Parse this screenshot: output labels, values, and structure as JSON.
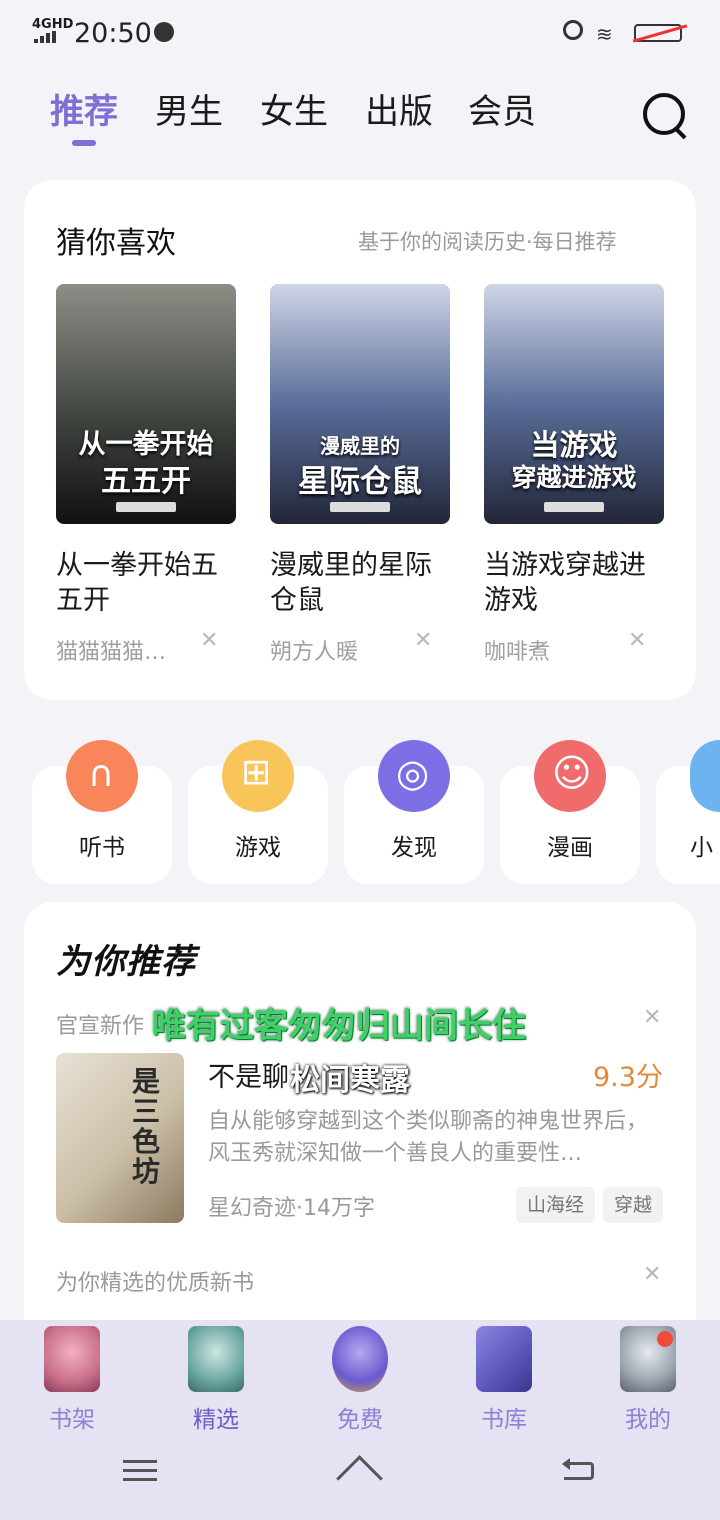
{
  "status_bar": {
    "network": "4GHD",
    "time": "20:50"
  },
  "top_tabs": [
    {
      "label": "推荐"
    },
    {
      "label": "男生"
    },
    {
      "label": "女生"
    },
    {
      "label": "出版"
    },
    {
      "label": "会员"
    }
  ],
  "guess": {
    "title": "猜你喜欢",
    "subtitle": "基于你的阅读历史·每日推荐",
    "books": [
      {
        "cover_line1": "从一拳开始",
        "cover_line2": "五五开",
        "name": "从一拳开始五五开",
        "author": "猫猫猫猫…",
        "color": "#3a3f3a"
      },
      {
        "cover_line1": "漫威里的",
        "cover_line2": "星际仓鼠",
        "name": "漫威里的星际仓鼠",
        "author": "朔方人暖",
        "color": "#4a5c8a"
      },
      {
        "cover_line1": "当游戏",
        "cover_line2": "穿越进游戏",
        "name": "当游戏穿越进游戏",
        "author": "咖啡煮",
        "color": "#4a5c8a"
      }
    ]
  },
  "quick": [
    {
      "label": "听书",
      "color": "#f9855a",
      "icon": "headphones-icon",
      "glyph": "∩"
    },
    {
      "label": "游戏",
      "color": "#f9c55a",
      "icon": "gamepad-icon",
      "glyph": "⊞"
    },
    {
      "label": "发现",
      "color": "#7c6fe6",
      "icon": "compass-icon",
      "glyph": "◎"
    },
    {
      "label": "漫画",
      "color": "#f06b6b",
      "icon": "comic-icon",
      "glyph": "☺"
    },
    {
      "label": "小",
      "color": "#6cb4f0",
      "icon": "bell-icon",
      "glyph": "◌"
    }
  ],
  "recommend": {
    "title": "为你推荐",
    "tag1": "官宣新作",
    "overlay_green": "唯有过客匆匆归山间长住",
    "book": {
      "title": "不是聊",
      "overlay_white": "松间寒露",
      "score": "9.3分",
      "desc": "自从能够穿越到这个类似聊斋的神鬼世界后，风玉秀就深知做一个善良人的重要性…",
      "meta": "星幻奇迹·14万字",
      "tags": [
        "山海经",
        "穿越"
      ],
      "cover_text": "是三色坊"
    },
    "tag2": "为你精选的优质新书"
  },
  "bottom_nav": [
    {
      "label": "书架",
      "icon": "butterfly-icon",
      "color": "#c9708a"
    },
    {
      "label": "精选",
      "icon": "castle-icon",
      "color": "#6aa6a0"
    },
    {
      "label": "免费",
      "icon": "vase-icon",
      "color": "#6a5acd"
    },
    {
      "label": "书库",
      "icon": "book-icon",
      "color": "#5a55b8"
    },
    {
      "label": "我的",
      "icon": "teapot-icon",
      "color": "#9aa3ad"
    }
  ]
}
